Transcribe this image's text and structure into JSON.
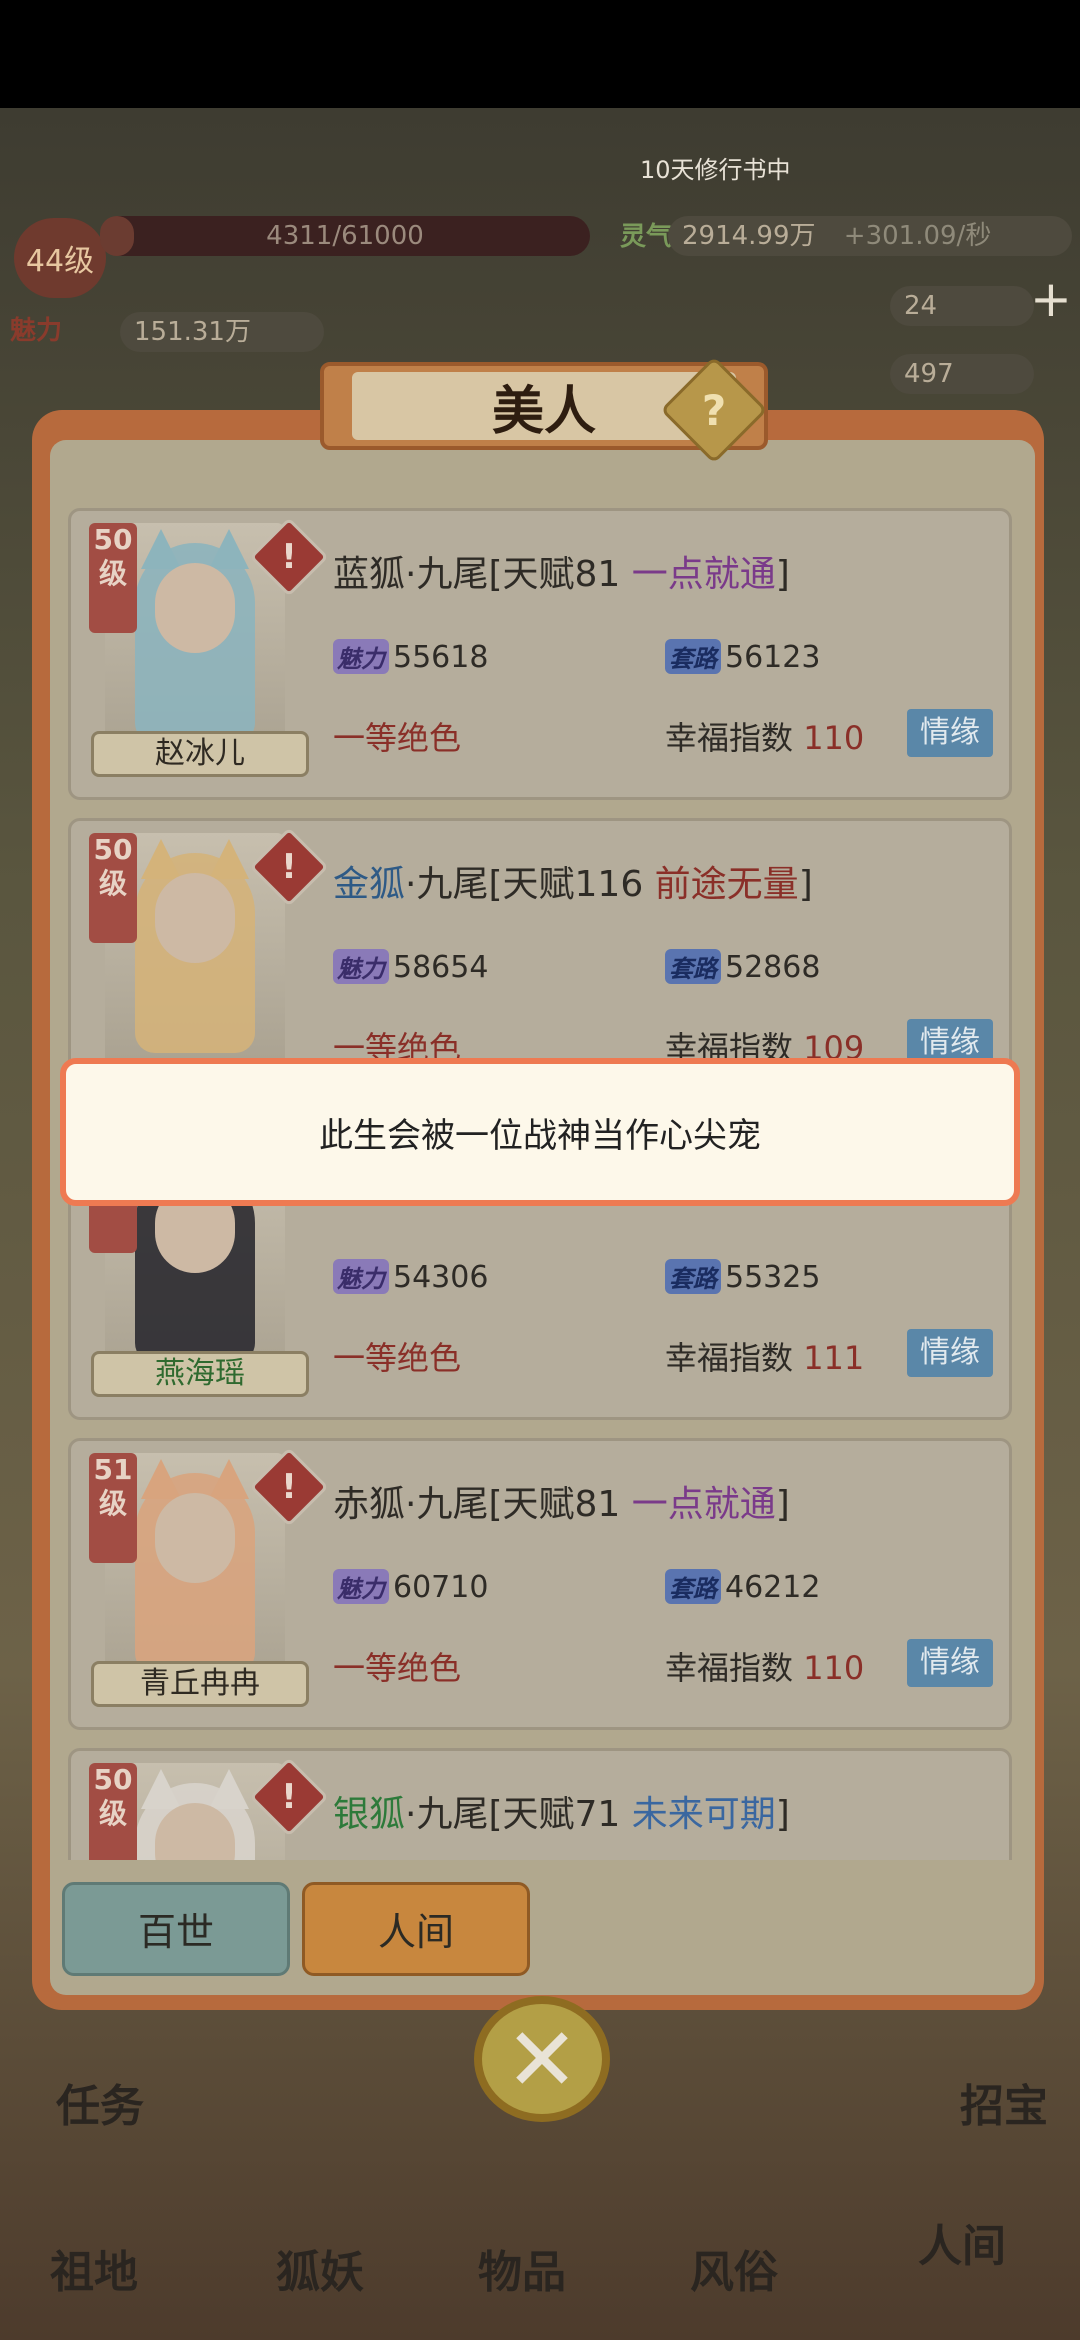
{
  "hud": {
    "level": "44级",
    "exp": "4311/61000",
    "exp_fraction": 0.07,
    "charm_label": "魅力",
    "charm_value": "151.31万",
    "income_label": "灵气",
    "income_value": "2914.99万",
    "income_rate": "+301.09/秒",
    "banner_text": "10天修行书中",
    "stat_a": "24",
    "stat_b": "497",
    "task_label": "任务",
    "treasure_label": "招宝"
  },
  "bottom_nav": [
    "祖地",
    "狐妖",
    "物品",
    "风俗",
    "人间"
  ],
  "dialog": {
    "title": "美人",
    "help_icon": "?",
    "close_icon": "✕",
    "tabs": {
      "baishi": "百世",
      "renjian": "人间"
    }
  },
  "cards": [
    {
      "level": "50级",
      "name": "赵冰儿",
      "species": "蓝狐",
      "tail": "·九尾",
      "talent": "[天赋81 ",
      "tag": "一点就通",
      "close": "]",
      "charm_label": "魅力",
      "charm": "55618",
      "scheme_label": "套路",
      "scheme": "56123",
      "grade": "一等绝色",
      "happy_label": "幸福指数 ",
      "happy": "110",
      "fate": "情缘"
    },
    {
      "level": "50级",
      "name": "",
      "species": "金狐",
      "tail": "·九尾",
      "talent": "[天赋116 ",
      "tag": "前途无量",
      "close": "]",
      "charm_label": "魅力",
      "charm": "58654",
      "scheme_label": "套路",
      "scheme": "52868",
      "grade": "一等绝色",
      "happy_label": "幸福指数 ",
      "happy": "109",
      "fate": "情缘"
    },
    {
      "level": "级",
      "name": "燕海瑶",
      "species": "",
      "tail": "",
      "talent": "",
      "tag": "",
      "close": "",
      "charm_label": "魅力",
      "charm": "54306",
      "scheme_label": "套路",
      "scheme": "55325",
      "grade": "一等绝色",
      "happy_label": "幸福指数 ",
      "happy": "111",
      "fate": "情缘"
    },
    {
      "level": "51级",
      "name": "青丘冉冉",
      "species": "赤狐",
      "tail": "·九尾",
      "talent": "[天赋81 ",
      "tag": "一点就通",
      "close": "]",
      "charm_label": "魅力",
      "charm": "60710",
      "scheme_label": "套路",
      "scheme": "46212",
      "grade": "一等绝色",
      "happy_label": "幸福指数 ",
      "happy": "110",
      "fate": "情缘"
    },
    {
      "level": "50级",
      "name": "",
      "species": "银狐",
      "tail": "·九尾",
      "talent": "[天赋71 ",
      "tag": "未来可期",
      "close": "]",
      "charm_label": "",
      "charm": "",
      "scheme_label": "",
      "scheme": "",
      "grade": "",
      "happy_label": "",
      "happy": "",
      "fate": ""
    }
  ],
  "toast": "此生会被一位战神当作心尖宠",
  "colors": {
    "species_blue": "#1f4aa0",
    "species_gold": "#2e5a86",
    "species_red": "#2e2b26",
    "species_silver": "#2d7a3a",
    "tag_purple": "#7a3a8a",
    "tag_red": "#8a2f28",
    "tag_blue": "#3a67a0",
    "hair_blue": "#8db4bc",
    "hair_gold": "#d4b37a",
    "hair_black": "#2b2a30",
    "hair_pink": "#d8a47e",
    "hair_white": "#d8d3cb"
  }
}
